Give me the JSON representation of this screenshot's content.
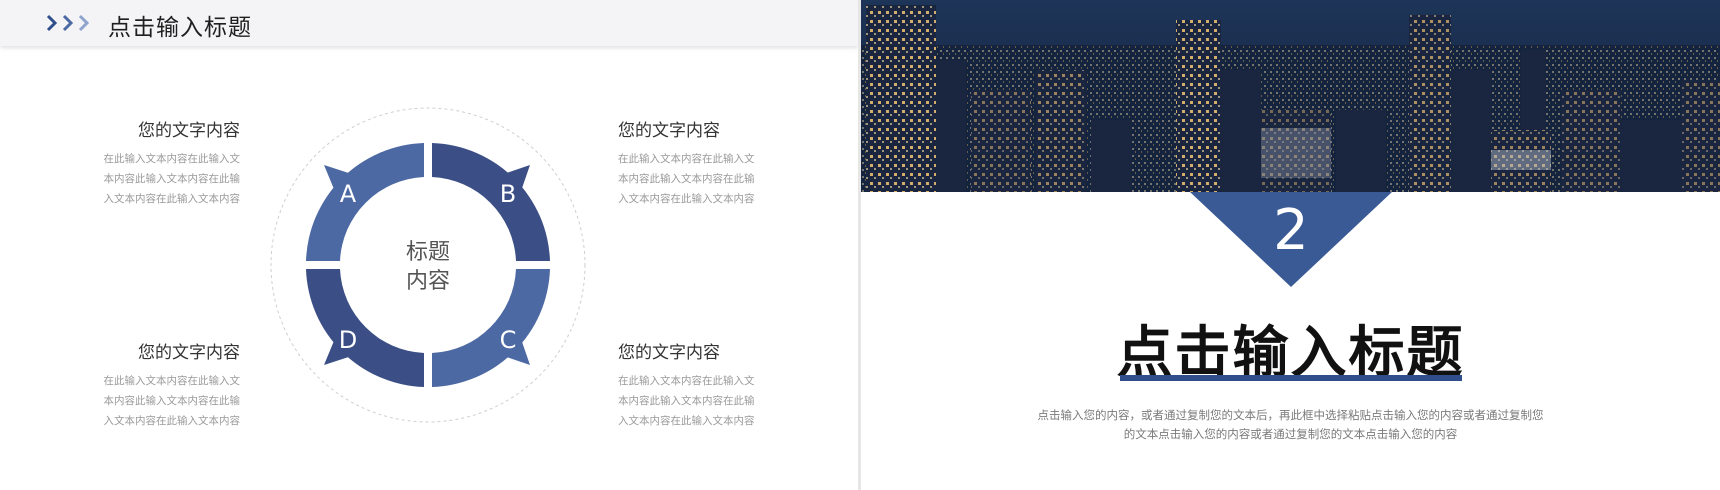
{
  "left_slide": {
    "header": {
      "chevron_icon": "triple-chevron-right-icon",
      "title": "点击输入标题"
    },
    "blocks": {
      "top_left": {
        "title": "您的文字内容",
        "lines": [
          "在此输入文本内容在此输入文",
          "本内容此输入文本内容在此输",
          "入文本内容在此输入文本内容"
        ]
      },
      "top_right": {
        "title": "您的文字内容",
        "lines": [
          "在此输入文本内容在此输入文",
          "本内容此输入文本内容在此输",
          "入文本内容在此输入文本内容"
        ]
      },
      "bottom_left": {
        "title": "您的文字内容",
        "lines": [
          "在此输入文本内容在此输入文",
          "本内容此输入文本内容在此输",
          "入文本内容在此输入文本内容"
        ]
      },
      "bottom_right": {
        "title": "您的文字内容",
        "lines": [
          "在此输入文本内容在此输入文",
          "本内容此输入文本内容在此输",
          "入文本内容在此输入文本内容"
        ]
      }
    },
    "cycle": {
      "center_line1": "标题",
      "center_line2": "内容",
      "segments": {
        "a": "A",
        "b": "B",
        "c": "C",
        "d": "D"
      },
      "colors": {
        "light": "#4c69a3",
        "dark": "#3b4f86"
      }
    }
  },
  "right_slide": {
    "photo": "night-city-skyline-image",
    "number": "2",
    "title": "点击输入标题",
    "subtitle_line1": "点击输入您的内容，或者通过复制您的文本后，再此框中选择粘贴点击输入您的内容或者通过复制您",
    "subtitle_line2": "的文本点击输入您的内容或者通过复制您的文本点击输入您的内容",
    "accent_color": "#2f4e8b"
  }
}
